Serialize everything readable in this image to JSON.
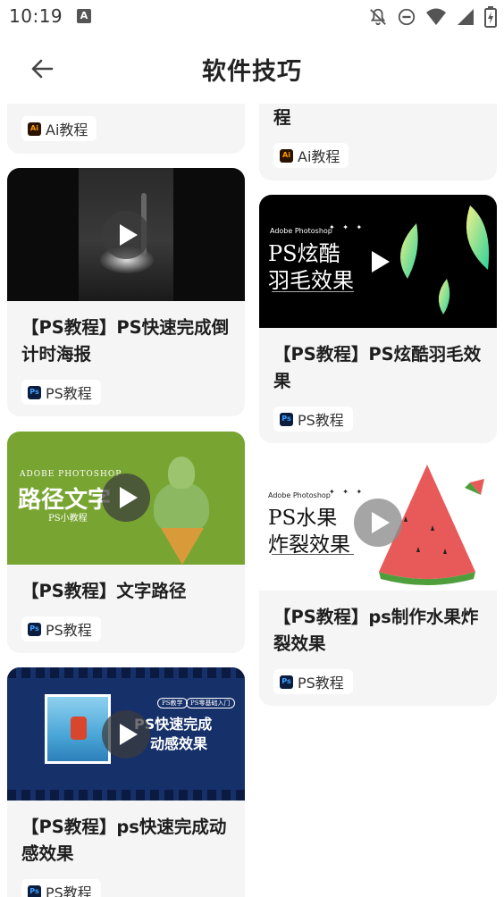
{
  "status_bar": {
    "time": "10:19",
    "notification_icon_letter": "A",
    "icons": [
      "bell-off-icon",
      "do-not-disturb-icon",
      "wifi-icon",
      "signal-icon",
      "battery-icon"
    ]
  },
  "header": {
    "title": "软件技巧",
    "back_icon": "arrow-left-icon"
  },
  "cards_left": [
    {
      "tag": "Ai教程",
      "tag_icon_text": "Ai"
    },
    {
      "title": "【PS教程】PS快速完成倒计时海报",
      "tag": "PS教程",
      "tag_icon_text": "Ps"
    },
    {
      "title": "【PS教程】文字路径",
      "tag": "PS教程",
      "tag_icon_text": "Ps",
      "thumb_brand": "ADOBE PHOTOSHOP",
      "thumb_title": "路径文字",
      "thumb_sub": "PS小教程"
    },
    {
      "title": "【PS教程】ps快速完成动感效果",
      "tag": "PS教程",
      "tag_icon_text": "Ps",
      "thumb_badge_1": "PS教学",
      "thumb_badge_2": "PS零基础入门",
      "thumb_title_1": "PS快速完成",
      "thumb_title_2": "动感效果"
    }
  ],
  "cards_right": [
    {
      "title_tail": "程",
      "tag": "Ai教程",
      "tag_icon_text": "Ai"
    },
    {
      "title": "【PS教程】PS炫酷羽毛效果",
      "tag": "PS教程",
      "tag_icon_text": "Ps",
      "thumb_brand": "Adobe Photoshop",
      "thumb_title_1": "PS炫酷",
      "thumb_title_2": "羽毛效果"
    },
    {
      "title": "【PS教程】ps制作水果炸裂效果",
      "tag": "PS教程",
      "tag_icon_text": "Ps",
      "thumb_brand": "Adobe Photoshop",
      "thumb_title_1": "PS水果",
      "thumb_title_2": "炸裂效果"
    }
  ],
  "colors": {
    "card_bg": "#f5f5f5",
    "ps_icon_bg": "#0b1d3f",
    "ps_icon_fg": "#3fa0ff",
    "ai_icon_bg": "#2b1300",
    "ai_icon_fg": "#ff9a00",
    "green_thumb": "#78a532",
    "navy_thumb": "#16306a"
  }
}
